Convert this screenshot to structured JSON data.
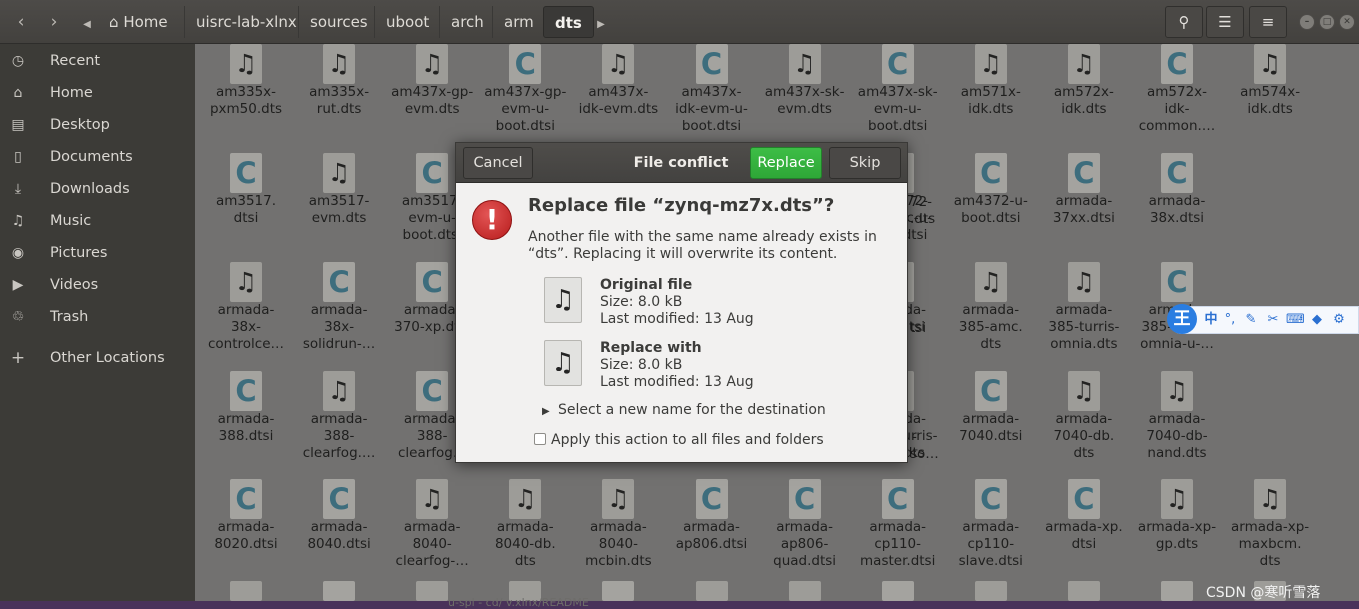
{
  "header": {
    "home_label": "Home",
    "breadcrumbs": [
      "uisrc-lab-xlnx",
      "sources",
      "uboot",
      "arch",
      "arm"
    ],
    "current": "dts"
  },
  "sidebar": {
    "items": [
      {
        "label": "Recent",
        "icon": "clock-icon"
      },
      {
        "label": "Home",
        "icon": "home-icon"
      },
      {
        "label": "Desktop",
        "icon": "folder-icon"
      },
      {
        "label": "Documents",
        "icon": "document-icon"
      },
      {
        "label": "Downloads",
        "icon": "download-icon"
      },
      {
        "label": "Music",
        "icon": "music-icon"
      },
      {
        "label": "Pictures",
        "icon": "camera-icon"
      },
      {
        "label": "Videos",
        "icon": "video-icon"
      },
      {
        "label": "Trash",
        "icon": "trash-icon"
      }
    ],
    "other_locations": "Other Locations"
  },
  "files": [
    {
      "name": "am335x-\npxm50.dts",
      "type": "music"
    },
    {
      "name": "am335x-\nrut.dts",
      "type": "music"
    },
    {
      "name": "am437x-gp-\nevm.dts",
      "type": "music"
    },
    {
      "name": "am437x-gp-\nevm-u-\nboot.dtsi",
      "type": "code"
    },
    {
      "name": "am437x-\nidk-evm.dts",
      "type": "music"
    },
    {
      "name": "am437x-\nidk-evm-u-\nboot.dtsi",
      "type": "code"
    },
    {
      "name": "am437x-sk-\nevm.dts",
      "type": "music"
    },
    {
      "name": "am437x-sk-\nevm-u-\nboot.dtsi",
      "type": "code"
    },
    {
      "name": "am571x-\nidk.dts",
      "type": "music"
    },
    {
      "name": "am572x-\nidk.dts",
      "type": "music"
    },
    {
      "name": "am572x-\nidk-\ncommon.…",
      "type": "code"
    },
    {
      "name": "am574x-\nidk.dts",
      "type": "music"
    },
    {
      "name": "am3517.\ndtsi",
      "type": "code"
    },
    {
      "name": "am3517-\nevm.dts",
      "type": "music"
    },
    {
      "name": "am3517-\nevm-u-\nboot.dtsi",
      "type": "code"
    },
    {
      "name": "",
      "type": "none"
    },
    {
      "name": "",
      "type": "none"
    },
    {
      "name": "",
      "type": "none"
    },
    {
      "name": "",
      "type": "none"
    },
    {
      "name": "am4372-\ngeneric-u-\nboot.dtsi",
      "type": "code"
    },
    {
      "name": "am4372-u-\nboot.dtsi",
      "type": "code"
    },
    {
      "name": "armada-\n37xx.dtsi",
      "type": "code"
    },
    {
      "name": "armada-\n38x.dtsi",
      "type": "code"
    },
    {
      "name": "",
      "type": "none"
    },
    {
      "name": "armada-\n38x-\ncontrolce…",
      "type": "music"
    },
    {
      "name": "armada-\n38x-\nsolidrun-…",
      "type": "code"
    },
    {
      "name": "armada-\n370-xp.dtsi",
      "type": "code"
    },
    {
      "name": "",
      "type": "none"
    },
    {
      "name": "",
      "type": "none"
    },
    {
      "name": "",
      "type": "none"
    },
    {
      "name": "",
      "type": "none"
    },
    {
      "name": "armada-\n385.dtsi",
      "type": "code"
    },
    {
      "name": "armada-\n385-amc.\ndts",
      "type": "music"
    },
    {
      "name": "armada-\n385-turris-\nomnia.dts",
      "type": "music"
    },
    {
      "name": "armada-\n385-turris-\nomnia-u-…",
      "type": "code"
    },
    {
      "name": "",
      "type": "none"
    },
    {
      "name": "armada-\n388.dtsi",
      "type": "code"
    },
    {
      "name": "armada-\n388-\nclearfog.…",
      "type": "music"
    },
    {
      "name": "armada-\n388-\nclearfog…",
      "type": "code"
    },
    {
      "name": "",
      "type": "none"
    },
    {
      "name": "",
      "type": "none"
    },
    {
      "name": "",
      "type": "none"
    },
    {
      "name": "",
      "type": "none"
    },
    {
      "name": "armada-\n3720-turris-\nmox.dts",
      "type": "music"
    },
    {
      "name": "armada-\n7040.dtsi",
      "type": "code"
    },
    {
      "name": "armada-\n7040-db.\ndts",
      "type": "music"
    },
    {
      "name": "armada-\n7040-db-\nnand.dts",
      "type": "music"
    },
    {
      "name": "",
      "type": "none"
    },
    {
      "name": "armada-\n8020.dtsi",
      "type": "code"
    },
    {
      "name": "armada-\n8040.dtsi",
      "type": "code"
    },
    {
      "name": "armada-\n8040-\nclearfog-…",
      "type": "music"
    },
    {
      "name": "armada-\n8040-db.\ndts",
      "type": "music"
    },
    {
      "name": "armada-\n8040-\nmcbin.dts",
      "type": "music"
    },
    {
      "name": "armada-\nap806.dtsi",
      "type": "code"
    },
    {
      "name": "armada-\nap806-\nquad.dtsi",
      "type": "code"
    },
    {
      "name": "armada-\ncp110-\nmaster.dtsi",
      "type": "code"
    },
    {
      "name": "armada-\ncp110-\nslave.dtsi",
      "type": "code"
    },
    {
      "name": "armada-xp.\ndtsi",
      "type": "code"
    },
    {
      "name": "armada-xp-\ngp.dts",
      "type": "music"
    },
    {
      "name": "armada-xp-\nmaxbcm.\ndts",
      "type": "music"
    }
  ],
  "partial_labels": {
    "c1": "72-",
    "c2": ".dts",
    "c3": "tsi",
    "c4": "-",
    "c5": "so…"
  },
  "dialog": {
    "cancel_label": "Cancel",
    "title": "File conflict",
    "replace_label": "Replace",
    "skip_label": "Skip",
    "heading": "Replace file “zynq-mz7x.dts”?",
    "message": "Another file with the same name already exists in “dts”. Replacing it will overwrite its content.",
    "original": {
      "title": "Original file",
      "size": "Size: 8.0 kB",
      "modified": "Last modified: 13 Aug"
    },
    "replacement": {
      "title": "Replace with",
      "size": "Size: 8.0 kB",
      "modified": "Last modified: 13 Aug"
    },
    "expander_label": "Select a new name for the destination",
    "apply_all_label": "Apply this action to all files and folders"
  },
  "ime": {
    "logo": "王",
    "mode": "中"
  },
  "bottom_text": "u-spl - cd/ v.xlnx/README",
  "watermark": "CSDN @寒听雪落"
}
